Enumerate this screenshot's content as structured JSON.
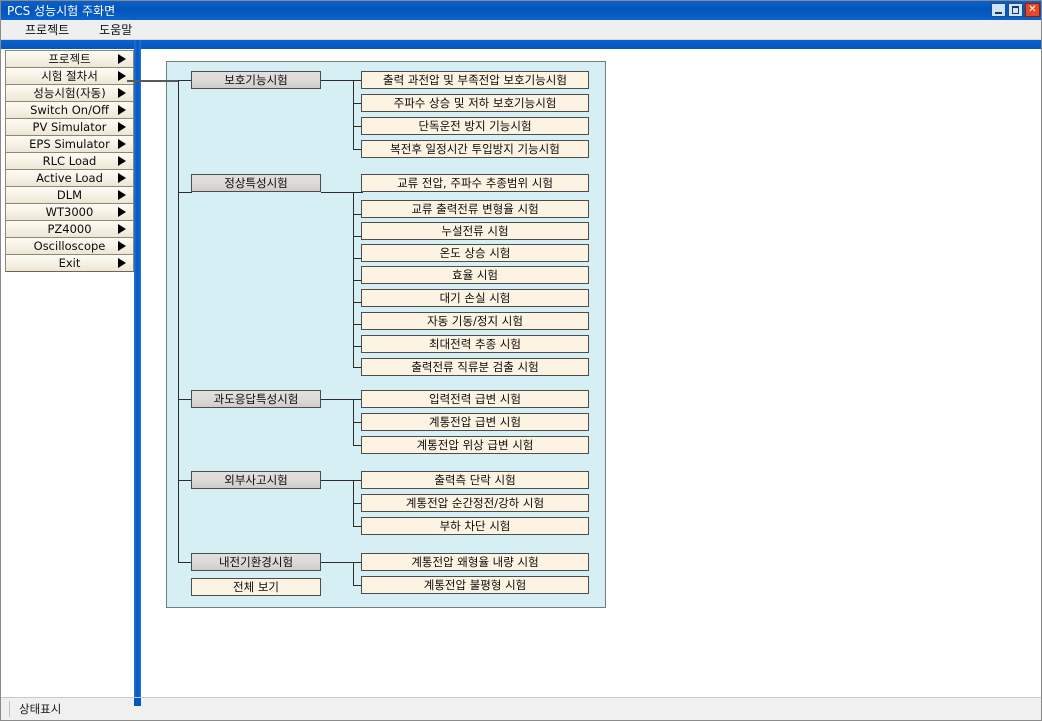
{
  "window": {
    "title": "PCS 성능시험 주화면",
    "controls": {
      "minimize": "_",
      "maximize": "□",
      "close": "✕"
    }
  },
  "menubar": {
    "items": [
      {
        "label": "프로젝트"
      },
      {
        "label": "도움말"
      }
    ]
  },
  "sidebar": {
    "items": [
      {
        "label": "프로젝트",
        "arrow": "▶"
      },
      {
        "label": "시험 절차서",
        "arrow": "▶"
      },
      {
        "label": "성능시험(자동)",
        "arrow": "▶"
      },
      {
        "label": "Switch On/Off",
        "arrow": "▶"
      },
      {
        "label": "PV Simulator",
        "arrow": "▶"
      },
      {
        "label": "EPS Simulator",
        "arrow": "▶"
      },
      {
        "label": "RLC Load",
        "arrow": "▶"
      },
      {
        "label": "Active Load",
        "arrow": "▶"
      },
      {
        "label": "DLM",
        "arrow": "▶"
      },
      {
        "label": "WT3000",
        "arrow": "▶"
      },
      {
        "label": "PZ4000",
        "arrow": "▶"
      },
      {
        "label": "Oscilloscope",
        "arrow": "▶"
      },
      {
        "label": "Exit",
        "arrow": "▶"
      }
    ]
  },
  "tree": {
    "groups": [
      {
        "label": "보호기능시험",
        "items": [
          {
            "label": "출력 과전압 및 부족전압 보호기능시험"
          },
          {
            "label": "주파수 상승 및 저하 보호기능시험"
          },
          {
            "label": "단독운전 방지 기능시험"
          },
          {
            "label": "복전후 일정시간 투입방지 기능시험"
          }
        ]
      },
      {
        "label": "정상특성시험",
        "items": [
          {
            "label": "교류 전압, 주파수 추종범위 시험"
          },
          {
            "label": "교류 출력전류 변형율 시험"
          },
          {
            "label": "누설전류 시험"
          },
          {
            "label": "온도 상승 시험"
          },
          {
            "label": "효율 시험"
          },
          {
            "label": "대기 손실 시험"
          },
          {
            "label": "자동 기동/정지 시험"
          },
          {
            "label": "최대전력 추종 시험"
          },
          {
            "label": "출력전류 직류분 검출 시험"
          }
        ]
      },
      {
        "label": "과도응답특성시험",
        "items": [
          {
            "label": "입력전력 급변 시험"
          },
          {
            "label": "계통전압 급변 시험"
          },
          {
            "label": "계통전압 위상 급변 시험"
          }
        ]
      },
      {
        "label": "외부사고시험",
        "items": [
          {
            "label": "출력측 단락 시험"
          },
          {
            "label": "계통전압 순간정전/강하 시험"
          },
          {
            "label": "부하 차단 시험"
          }
        ]
      },
      {
        "label": "내전기환경시험",
        "items": [
          {
            "label": "계통전압 왜형율 내량 시험"
          },
          {
            "label": "계통전압 불평형 시험"
          }
        ]
      }
    ],
    "view_all_label": "전체 보기"
  },
  "statusbar": {
    "text": "상태표시"
  },
  "colors": {
    "titlebar": "#0355bb",
    "panel_background": "#d5eff4",
    "category_box": "#dcd9d6",
    "item_box": "#fdf3e2",
    "sidebar_button": "#f6f1e4",
    "close_button": "#e8482a"
  }
}
